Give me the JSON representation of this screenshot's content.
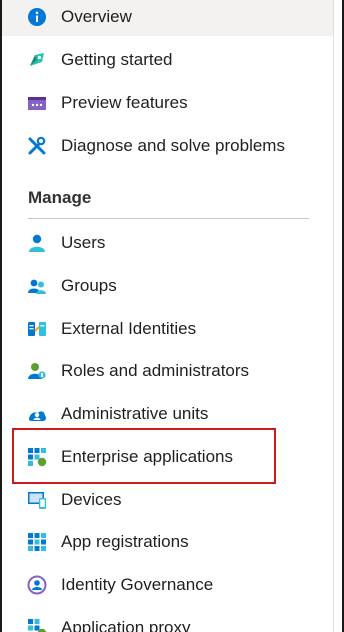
{
  "nav": {
    "items": [
      {
        "label": "Overview",
        "icon": "info-icon"
      },
      {
        "label": "Getting started",
        "icon": "rocket-icon"
      },
      {
        "label": "Preview features",
        "icon": "preview-icon"
      },
      {
        "label": "Diagnose and solve problems",
        "icon": "wrench-icon"
      }
    ],
    "section_title": "Manage",
    "manage_items": [
      {
        "label": "Users",
        "icon": "user-icon"
      },
      {
        "label": "Groups",
        "icon": "group-icon"
      },
      {
        "label": "External Identities",
        "icon": "external-identities-icon"
      },
      {
        "label": "Roles and administrators",
        "icon": "roles-icon"
      },
      {
        "label": "Administrative units",
        "icon": "admin-units-icon"
      },
      {
        "label": "Enterprise applications",
        "icon": "enterprise-apps-icon"
      },
      {
        "label": "Devices",
        "icon": "devices-icon"
      },
      {
        "label": "App registrations",
        "icon": "app-registrations-icon"
      },
      {
        "label": "Identity Governance",
        "icon": "identity-governance-icon"
      },
      {
        "label": "Application proxy",
        "icon": "application-proxy-icon"
      }
    ],
    "selected": "Overview",
    "highlighted": "Enterprise applications"
  },
  "colors": {
    "accent": "#0078d4",
    "highlight_border": "#d0191e",
    "selected_bg": "#f3f2f1"
  }
}
